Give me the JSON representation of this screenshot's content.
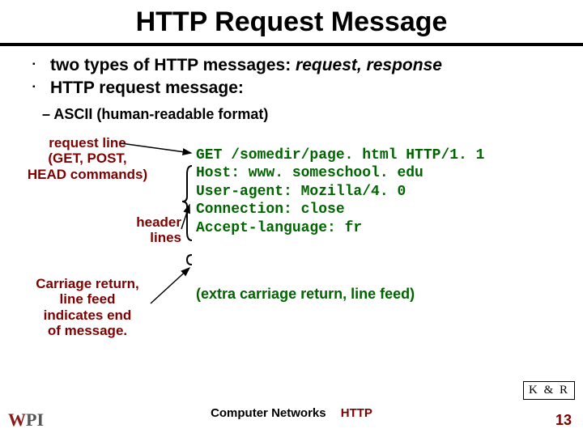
{
  "title": "HTTP Request Message",
  "bullets": {
    "line1_a": "two types of HTTP messages: ",
    "line1_b": "request, response",
    "line2": "HTTP request message:",
    "sub1": "ASCII (human-readable format)"
  },
  "labels": {
    "request_line": "request line\n(GET, POST,\nHEAD commands)",
    "header_lines": "header\nlines",
    "crlf": "Carriage return,\nline feed\nindicates end\nof message."
  },
  "code": {
    "l1": "GET /somedir/page. html HTTP/1. 1",
    "l2": "Host: www. someschool. edu",
    "l3": "User-agent: Mozilla/4. 0",
    "l4": "Connection: close",
    "l5": "Accept-language: fr"
  },
  "extra": "(extra carriage return, line feed)",
  "kr": "K & R",
  "footer": {
    "course": "Computer Networks",
    "topic": "HTTP",
    "page": "13"
  }
}
